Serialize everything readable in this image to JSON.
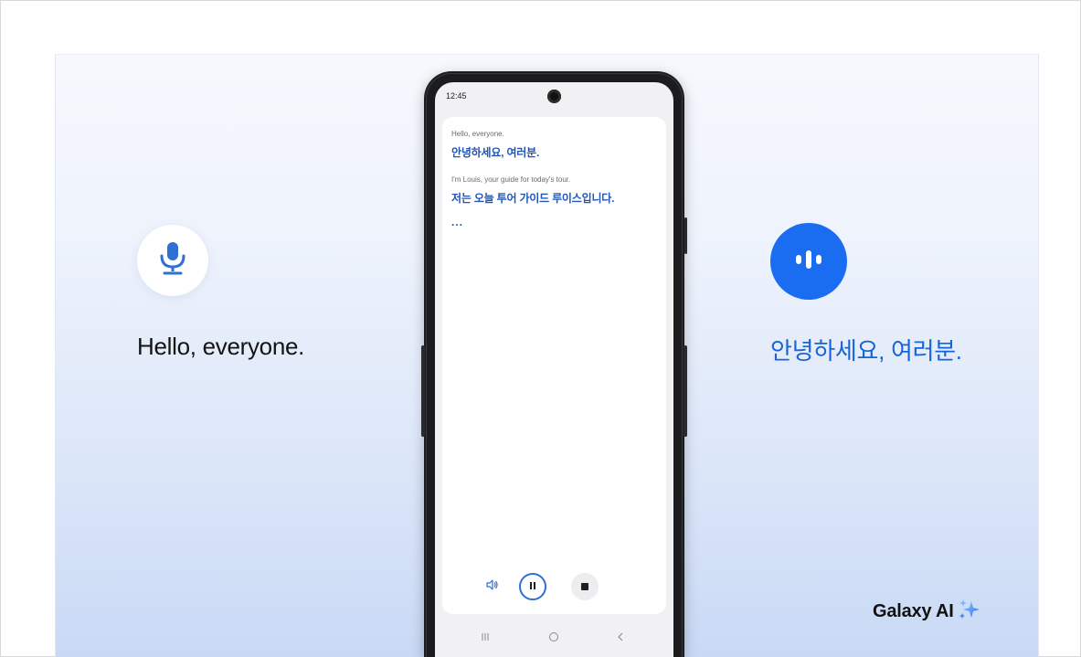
{
  "left_panel": {
    "icon": "microphone-icon",
    "text": "Hello, everyone."
  },
  "right_panel": {
    "icon": "voice-waveform-icon",
    "text": "안녕하세요, 여러분."
  },
  "brand": {
    "text": "Galaxy AI",
    "icon": "sparkle-icon"
  },
  "phone": {
    "status_time": "12:45",
    "transcript": [
      {
        "source": "Hello, everyone.",
        "translation": "안녕하세요, 여러분."
      },
      {
        "source": "I'm Louis, your guide for today's tour.",
        "translation": "저는 오늘 투어 가이드 루이스입니다."
      }
    ],
    "typing_indicator": "...",
    "controls": [
      "volume-icon",
      "pause-icon",
      "stop-icon"
    ],
    "navbar": [
      "recent-apps-icon",
      "home-icon",
      "back-icon"
    ]
  },
  "colors": {
    "accent": "#1a6cf0",
    "translation_text": "#1f56b8",
    "right_text": "#1763d8"
  }
}
